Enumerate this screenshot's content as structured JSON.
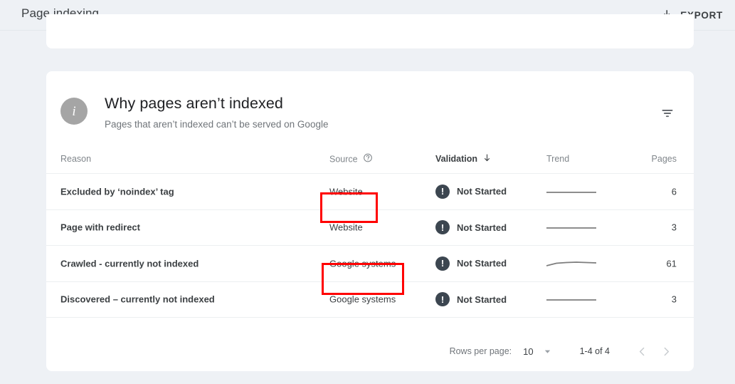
{
  "topbar": {
    "title": "Page indexing",
    "export_label": "EXPORT",
    "export_icon": "download-icon"
  },
  "card": {
    "info_icon": "info-icon",
    "info_glyph": "i",
    "title": "Why pages aren’t indexed",
    "subtitle": "Pages that aren’t indexed can’t be served on Google",
    "filter_icon": "filter-icon"
  },
  "table": {
    "columns": [
      {
        "key": "reason",
        "label": "Reason",
        "sorted": false,
        "help": false
      },
      {
        "key": "source",
        "label": "Source",
        "sorted": false,
        "help": true,
        "help_icon": "help-circle-icon"
      },
      {
        "key": "validation",
        "label": "Validation",
        "sorted": true,
        "help": false,
        "sort_icon": "arrow-down-icon",
        "sort_glyph": "↓"
      },
      {
        "key": "trend",
        "label": "Trend",
        "sorted": false,
        "help": false
      },
      {
        "key": "pages",
        "label": "Pages",
        "sorted": false,
        "help": false
      }
    ],
    "rows": [
      {
        "reason": "Excluded by ‘noindex’ tag",
        "source": "Website",
        "validation": "Not Started",
        "validation_icon": "error-exclamation-icon",
        "pages": "6",
        "trend": [
          5,
          5,
          5,
          5,
          5,
          5
        ]
      },
      {
        "reason": "Page with redirect",
        "source": "Website",
        "validation": "Not Started",
        "validation_icon": "error-exclamation-icon",
        "pages": "3",
        "trend": [
          5,
          5,
          5,
          5,
          5,
          5
        ]
      },
      {
        "reason": "Crawled - currently not indexed",
        "source": "Google systems",
        "validation": "Not Started",
        "validation_icon": "error-exclamation-icon",
        "pages": "61",
        "trend": [
          8,
          6,
          4,
          3,
          3,
          3
        ]
      },
      {
        "reason": "Discovered – currently not indexed",
        "source": "Google systems",
        "validation": "Not Started",
        "validation_icon": "error-exclamation-icon",
        "pages": "3",
        "trend": [
          5,
          5,
          5,
          5,
          5,
          5
        ]
      }
    ]
  },
  "footer": {
    "rows_per_page_label": "Rows per page:",
    "rows_per_page_value": "10",
    "caret_icon": "chevron-down-icon",
    "range_label": "1-4 of 4",
    "prev_icon": "chevron-left-icon",
    "next_icon": "chevron-right-icon"
  },
  "annotations": [
    {
      "name": "highlight-source-website",
      "target": "row-0-source"
    },
    {
      "name": "highlight-source-google-systems",
      "target": "row-2-source"
    }
  ],
  "colors": {
    "page_bg": "#eef1f5",
    "card_bg": "#ffffff",
    "text_primary": "#3c4043",
    "text_secondary": "#70757a",
    "status_icon": "#3c4650",
    "annotation": "#ff0000",
    "divider": "#eceff1"
  }
}
